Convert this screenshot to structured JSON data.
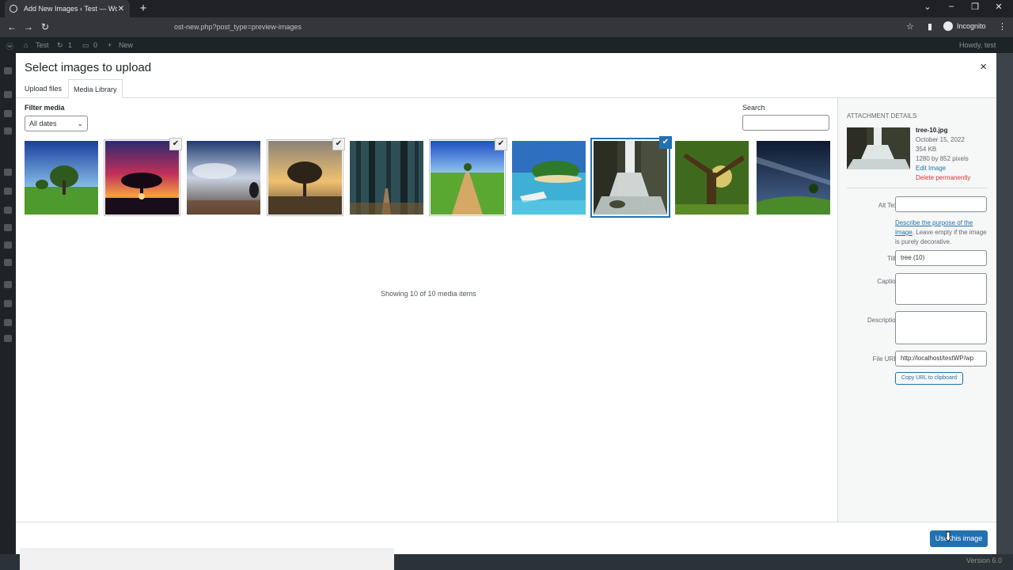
{
  "browser": {
    "tab_title": "Add New Images ‹ Test — WordPress",
    "tab_close": "✕",
    "new_tab": "+",
    "url": "ost-new.php?post_type=preview-images",
    "incognito_label": "Incognito"
  },
  "adminbar": {
    "site_name": "Test",
    "updates_count": "1",
    "comments_count": "0",
    "new_label": "New",
    "howdy": "Howdy, test"
  },
  "modal": {
    "title": "Select images to upload",
    "close_glyph": "×",
    "tabs": [
      {
        "label": "Upload files",
        "active": false
      },
      {
        "label": "Media Library",
        "active": true
      }
    ],
    "filter_label": "Filter media",
    "date_filter": "All dates",
    "search_label": "Search",
    "search_value": "",
    "items": [
      {
        "alt": "meadow trees",
        "selected": false
      },
      {
        "alt": "sunset tree",
        "selected": true
      },
      {
        "alt": "cloud reflection",
        "selected": false
      },
      {
        "alt": "lone tree sunrise",
        "selected": true
      },
      {
        "alt": "forest",
        "selected": false
      },
      {
        "alt": "road to tree",
        "selected": true
      },
      {
        "alt": "tropical island",
        "selected": false
      },
      {
        "alt": "waterfall",
        "selected": true
      },
      {
        "alt": "old tree",
        "selected": false
      },
      {
        "alt": "hill tree night",
        "selected": false
      }
    ],
    "count_text": "Showing 10 of 10 media items",
    "check_glyph": "✔",
    "use_button": "Use this image"
  },
  "details": {
    "heading": "ATTACHMENT DETAILS",
    "filename": "tree-10.jpg",
    "date": "October 15, 2022",
    "size": "354 KB",
    "dimensions": "1280 by 852 pixels",
    "edit_link": "Edit Image",
    "delete_link": "Delete permanently",
    "alt_label": "Alt Text",
    "alt_value": "",
    "alt_help_link": "Describe the purpose of the image",
    "alt_help_rest": ". Leave empty if the image is purely decorative.",
    "title_label": "Title",
    "title_value": "tree (10)",
    "caption_label": "Caption",
    "caption_value": "",
    "description_label": "Description",
    "description_value": "",
    "file_url_label": "File URL:",
    "file_url_value": "http://localhost/testWP/wp",
    "copy_button": "Copy URL to clipboard"
  },
  "footer": {
    "version": "Version 6.0"
  }
}
